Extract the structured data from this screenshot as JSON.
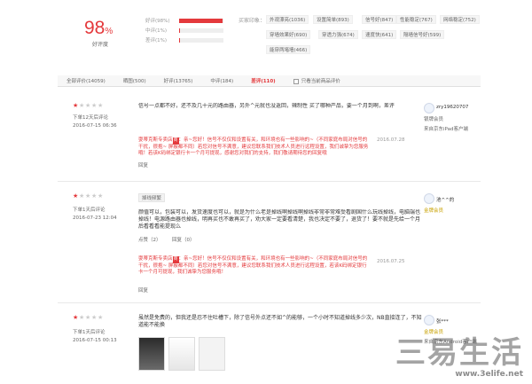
{
  "summary": {
    "rate_number": "98",
    "rate_symbol": "%",
    "rate_label": "好评度",
    "bars": [
      {
        "label": "好评(98%)",
        "fill": 0.98
      },
      {
        "label": "中评(1%)",
        "fill": 0.01
      },
      {
        "label": "差评(1%)",
        "fill": 0.01
      }
    ]
  },
  "impressions": {
    "title": "买家印象：",
    "tags": [
      "外观漂亮(1036)",
      "设置简单(893)",
      "信号好(847)",
      "性能稳定(767)",
      "网络稳定(752)",
      "穿墙效果好(690)",
      "穿透力强(674)",
      "速度快(641)",
      "隔墙信号好(599)",
      "能穿两堵墙(466)"
    ]
  },
  "tabs": {
    "items": [
      {
        "label": "全部评价(14059)"
      },
      {
        "label": "晒图(500)"
      },
      {
        "label": "好评(13765)"
      },
      {
        "label": "中评(184)"
      },
      {
        "label": "差评(110)"
      }
    ],
    "checkbox_label": "只看当前商品评价"
  },
  "reviews": [
    {
      "date_label": "下单12天后评论",
      "datetime": "2016-07-15 06:36",
      "content": "信号一点都不好，还不及几十元的路由器，另外^元就也没返回，辣制性 买了哪种产品，要一个月到啊，差评",
      "reply_from": "耍蒂克斯专卖店",
      "reply_badge": "商",
      "reply_text": "：亲~您好！信号不仅仅和设置有关，和环境也有一些影响的~（不同家庭布局对信号的干扰，很抱~ 屏蔽都不同）若您对信号不满意，建议您联系我们技术人员进行远程设置，我们诚挚为您服务哦！若该K码绑定银行卡一个月可提现，感谢您对我们的支持，我们敬请期待您的回复哦",
      "reply_date": "2016.07.28",
      "reply_action": "回复",
      "user_name": "zry19620707",
      "user_level": "银牌会员",
      "user_client": "来自京东iPad客户端"
    },
    {
      "date_label": "下单1天后评论",
      "datetime": "2016-07-23 12:04",
      "tag": "掉线频繁",
      "content": "颜值可以，包装可以，发货速度也可以，就是为什么老是掉线啊掉线啊掉线非常非常难受看剧国什么玩线掉线，电脑端也掉线！电源路由器也掉线，明再买也不敢再买了，劝大家一定要看清楚，我也决定不要了，退货了！要不就是先给一个月后看看看能提现么",
      "likes": "点赞（2）",
      "comment_reply": "回复（0）",
      "reply_from": "耍蒂克斯专卖店",
      "reply_badge": "商",
      "reply_text": "：亲~您好！信号不仅仅和设置有关，和环境也有一些影响的~（不同家庭布局对信号的干扰，很抱~ 屏蔽都不同）若您对信号不满意，建议您联系我们技术人员进行远程设置，若该K码绑定银行卡一个月可提现，我们诚挚为您服务哦！",
      "reply_date": "2016.07.25",
      "reply_action": "回复",
      "user_name": "池^^的",
      "user_level": "金牌会员",
      "user_client": ""
    },
    {
      "date_label": "下单1天后评论",
      "datetime": "2016-07-15 00:13",
      "content": "虽然是免费的，但我还是忍不住吐槽下，除了信号外点还不如^的能够，一个小时不知道掉线多少次，NB直接连了，不知道能不能换",
      "user_name": "张***",
      "user_level": "金牌会员",
      "user_client": "来自京东Android客户端"
    }
  ],
  "watermark": {
    "big": "三易生活",
    "url": "www.3elife.net"
  }
}
